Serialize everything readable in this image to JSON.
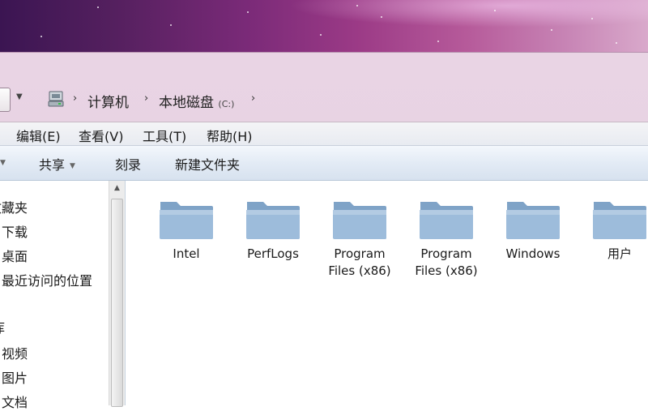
{
  "address": {
    "path": [
      "计算机",
      "本地磁盘"
    ],
    "drive_letter": "(C:)"
  },
  "menu": [
    "编辑(E)",
    "查看(V)",
    "工具(T)",
    "帮助(H)"
  ],
  "toolbar": {
    "share_label": "共享",
    "burn_label": "刻录",
    "new_folder_label": "新建文件夹"
  },
  "navigation": {
    "favorites_header": "收藏夹",
    "favorites": [
      "下载",
      "桌面",
      "最近访问的位置"
    ],
    "libraries_header": "库",
    "libraries": [
      "视频",
      "图片",
      "文档"
    ]
  },
  "folders": [
    {
      "line1": "Intel",
      "line2": ""
    },
    {
      "line1": "PerfLogs",
      "line2": ""
    },
    {
      "line1": "Program",
      "line2": "Files (x86)"
    },
    {
      "line1": "Program",
      "line2": "Files (x86)"
    },
    {
      "line1": "Windows",
      "line2": ""
    },
    {
      "line1": "用户",
      "line2": ""
    }
  ],
  "icons": {
    "drive": "computer-drive-icon",
    "folder": "folder-icon",
    "separator": "breadcrumb-chevron-icon"
  },
  "colors": {
    "folder_blue": "#8aaed0",
    "toolbar_blue": "#dfe8f3",
    "wallpaper_purple": "#7a2a78"
  }
}
